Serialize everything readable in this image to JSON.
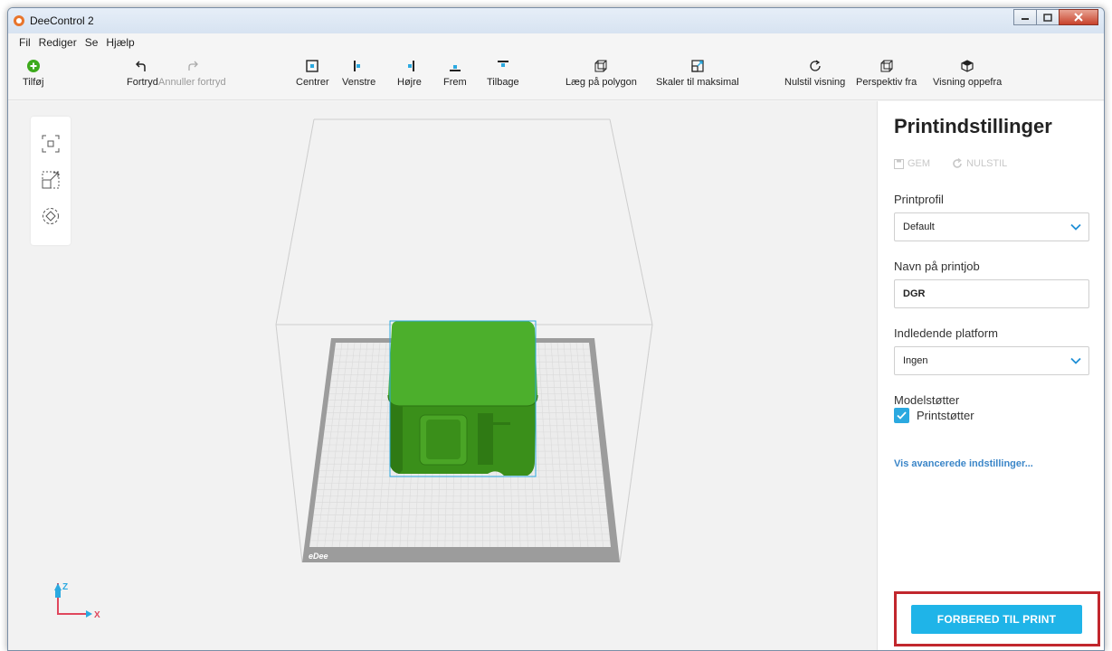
{
  "window": {
    "title": "DeeControl 2",
    "controls": [
      "—",
      "□",
      "X"
    ]
  },
  "menu": [
    "Fil",
    "Rediger",
    "Se",
    "Hjælp"
  ],
  "toolbar": {
    "add": "Tilføj",
    "undo": "Fortryd",
    "redo": "Annuller fortryd",
    "center": "Centrer",
    "left": "Venstre",
    "right": "Højre",
    "front": "Frem",
    "back": "Tilbage",
    "lay_flat": "Læg på polygon",
    "scale_max": "Skaler til maksimal",
    "reset_view": "Nulstil visning",
    "perspective": "Perspektiv fra",
    "top_view": "Visning oppefra"
  },
  "viewport": {
    "bed_brand": "eDee",
    "axis_z": "Z",
    "axis_x": "X",
    "model_color": "#3f9a1f",
    "highlight_color": "#2ba9e0"
  },
  "panel": {
    "title": "Printindstillinger",
    "save": "GEM",
    "reset": "NULSTIL",
    "profile_label": "Printprofil",
    "profile_value": "Default",
    "jobname_label": "Navn på printjob",
    "jobname_value": "DGR",
    "platform_label": "Indledende platform",
    "platform_value": "Ingen",
    "supports_label": "Modelstøtter",
    "supports_checkbox": "Printstøtter",
    "supports_checked": true,
    "advanced_link": "Vis avancerede indstillinger...",
    "prepare_button": "FORBERED TIL PRINT"
  }
}
